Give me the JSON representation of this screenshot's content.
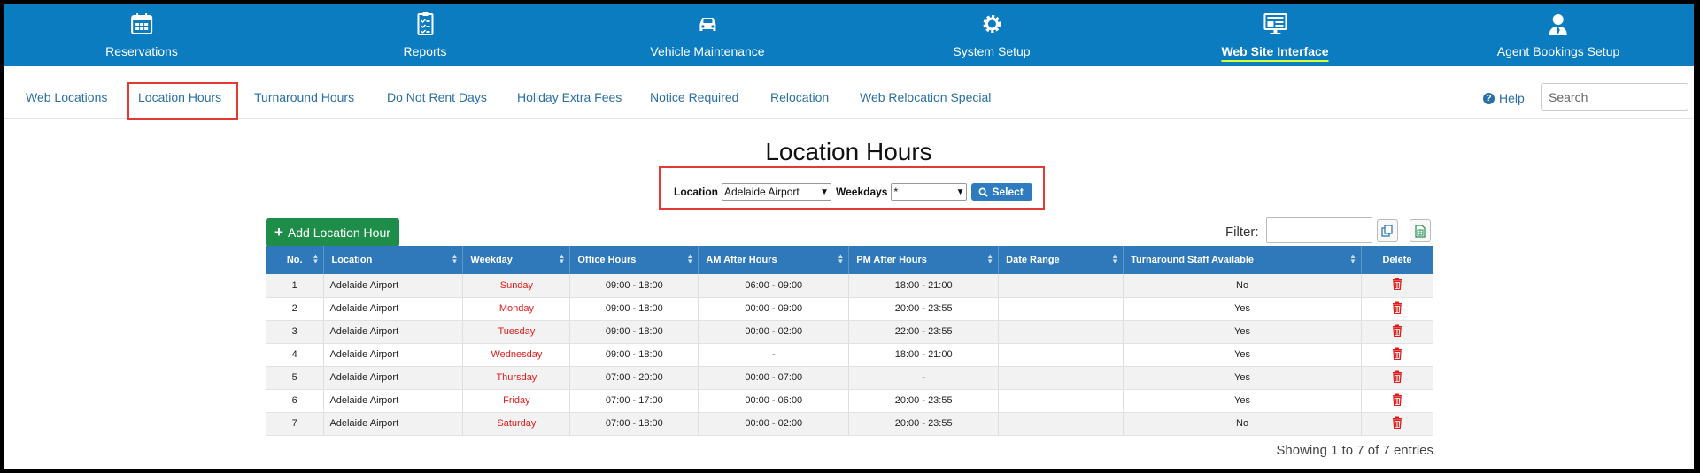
{
  "topnav": {
    "items": [
      {
        "label": "Reservations",
        "icon": "calendar-icon"
      },
      {
        "label": "Reports",
        "icon": "clipboard-checklist-icon"
      },
      {
        "label": "Vehicle Maintenance",
        "icon": "car-icon"
      },
      {
        "label": "System Setup",
        "icon": "gear-icon"
      },
      {
        "label": "Web Site Interface",
        "icon": "monitor-icon",
        "active": true
      },
      {
        "label": "Agent Bookings Setup",
        "icon": "agent-icon"
      }
    ]
  },
  "subtabs": {
    "items": [
      {
        "label": "Web Locations"
      },
      {
        "label": "Location Hours",
        "highlighted": true
      },
      {
        "label": "Turnaround Hours"
      },
      {
        "label": "Do Not Rent Days"
      },
      {
        "label": "Holiday Extra Fees"
      },
      {
        "label": "Notice Required"
      },
      {
        "label": "Relocation"
      },
      {
        "label": "Web Relocation Special"
      }
    ],
    "help_label": "Help",
    "search_placeholder": "Search"
  },
  "page": {
    "title": "Location Hours",
    "form": {
      "location_label": "Location",
      "location_value": "Adelaide Airport",
      "weekdays_label": "Weekdays",
      "weekdays_value": "*",
      "select_button": "Select"
    },
    "add_button": "Add Location Hour",
    "filter_label": "Filter:",
    "showing_text": "Showing 1 to 7 of 7 entries"
  },
  "table": {
    "columns": [
      "No.",
      "Location",
      "Weekday",
      "Office Hours",
      "AM After Hours",
      "PM After Hours",
      "Date Range",
      "Turnaround Staff Available",
      "Delete"
    ],
    "rows": [
      {
        "no": "1",
        "location": "Adelaide Airport",
        "weekday": "Sunday",
        "office": "09:00 - 18:00",
        "am": "06:00 - 09:00",
        "pm": "18:00 - 21:00",
        "range": "",
        "staff": "No"
      },
      {
        "no": "2",
        "location": "Adelaide Airport",
        "weekday": "Monday",
        "office": "09:00 - 18:00",
        "am": "00:00 - 09:00",
        "pm": "20:00 - 23:55",
        "range": "",
        "staff": "Yes"
      },
      {
        "no": "3",
        "location": "Adelaide Airport",
        "weekday": "Tuesday",
        "office": "09:00 - 18:00",
        "am": "00:00 - 02:00",
        "pm": "22:00 - 23:55",
        "range": "",
        "staff": "Yes"
      },
      {
        "no": "4",
        "location": "Adelaide Airport",
        "weekday": "Wednesday",
        "office": "09:00 - 18:00",
        "am": "-",
        "pm": "18:00 - 21:00",
        "range": "",
        "staff": "Yes"
      },
      {
        "no": "5",
        "location": "Adelaide Airport",
        "weekday": "Thursday",
        "office": "07:00 - 20:00",
        "am": "00:00 - 07:00",
        "pm": "-",
        "range": "",
        "staff": "Yes"
      },
      {
        "no": "6",
        "location": "Adelaide Airport",
        "weekday": "Friday",
        "office": "07:00 - 17:00",
        "am": "00:00 - 06:00",
        "pm": "20:00 - 23:55",
        "range": "",
        "staff": "Yes"
      },
      {
        "no": "7",
        "location": "Adelaide Airport",
        "weekday": "Saturday",
        "office": "07:00 - 18:00",
        "am": "00:00 - 02:00",
        "pm": "20:00 - 23:55",
        "range": "",
        "staff": "No"
      }
    ]
  },
  "colors": {
    "nav_bg": "#0c7cc1",
    "table_header": "#2f78b9",
    "weekday_red": "#e21b1b",
    "add_green": "#1f8d4a",
    "highlight_red": "#e53935"
  }
}
